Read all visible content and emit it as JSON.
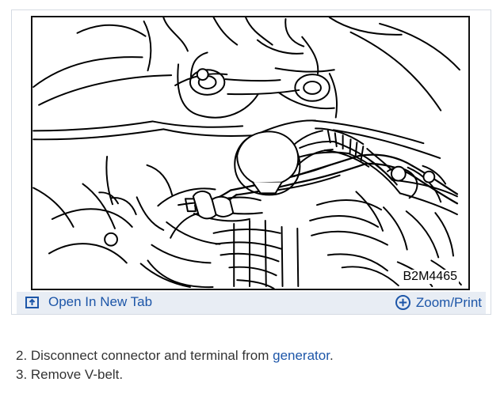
{
  "figure": {
    "image_code": "B2M4465",
    "toolbar": {
      "open_tab_label": "Open In New Tab",
      "zoom_print_label": "Zoom/Print"
    },
    "icons": {
      "open_tab": "open-new-tab-icon",
      "zoom": "zoom-icon"
    }
  },
  "instructions": {
    "step_2_prefix": "2. Disconnect connector and terminal from ",
    "step_2_link": "generator",
    "step_2_suffix": ".",
    "step_3": "3. Remove V-belt."
  },
  "colors": {
    "link": "#1d56a8",
    "toolbar_background": "#e8edf4",
    "body_text": "#333333"
  }
}
